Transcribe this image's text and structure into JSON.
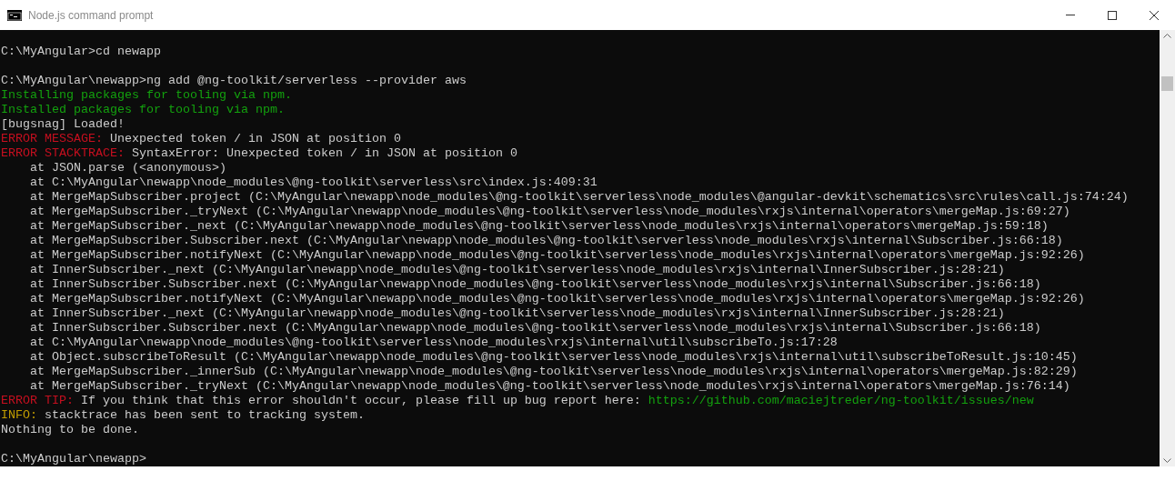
{
  "window": {
    "title": "Node.js command prompt"
  },
  "console": {
    "lines": [
      {
        "kind": "blank"
      },
      {
        "kind": "text",
        "segments": [
          {
            "kind": "plain",
            "text": "C:\\MyAngular>cd newapp"
          }
        ]
      },
      {
        "kind": "blank"
      },
      {
        "kind": "text",
        "segments": [
          {
            "kind": "plain",
            "text": "C:\\MyAngular\\newapp>ng add @ng-toolkit/serverless --provider aws"
          }
        ]
      },
      {
        "kind": "text",
        "segments": [
          {
            "kind": "success",
            "text": "Installing packages for tooling via npm."
          }
        ]
      },
      {
        "kind": "text",
        "segments": [
          {
            "kind": "success",
            "text": "Installed packages for tooling via npm."
          }
        ]
      },
      {
        "kind": "text",
        "segments": [
          {
            "kind": "plain",
            "text": "[bugsnag] Loaded!"
          }
        ]
      },
      {
        "kind": "text",
        "segments": [
          {
            "kind": "error",
            "text": "ERROR MESSAGE:"
          },
          {
            "kind": "plain",
            "text": " Unexpected token / in JSON at position 0"
          }
        ]
      },
      {
        "kind": "text",
        "segments": [
          {
            "kind": "error",
            "text": "ERROR STACKTRACE:"
          },
          {
            "kind": "plain",
            "text": " SyntaxError: Unexpected token / in JSON at position 0"
          }
        ]
      },
      {
        "kind": "text",
        "segments": [
          {
            "kind": "plain",
            "text": "    at JSON.parse (<anonymous>)"
          }
        ]
      },
      {
        "kind": "text",
        "segments": [
          {
            "kind": "plain",
            "text": "    at C:\\MyAngular\\newapp\\node_modules\\@ng-toolkit\\serverless\\src\\index.js:409:31"
          }
        ]
      },
      {
        "kind": "text",
        "segments": [
          {
            "kind": "plain",
            "text": "    at MergeMapSubscriber.project (C:\\MyAngular\\newapp\\node_modules\\@ng-toolkit\\serverless\\node_modules\\@angular-devkit\\schematics\\src\\rules\\call.js:74:24)"
          }
        ]
      },
      {
        "kind": "text",
        "segments": [
          {
            "kind": "plain",
            "text": "    at MergeMapSubscriber._tryNext (C:\\MyAngular\\newapp\\node_modules\\@ng-toolkit\\serverless\\node_modules\\rxjs\\internal\\operators\\mergeMap.js:69:27)"
          }
        ]
      },
      {
        "kind": "text",
        "segments": [
          {
            "kind": "plain",
            "text": "    at MergeMapSubscriber._next (C:\\MyAngular\\newapp\\node_modules\\@ng-toolkit\\serverless\\node_modules\\rxjs\\internal\\operators\\mergeMap.js:59:18)"
          }
        ]
      },
      {
        "kind": "text",
        "segments": [
          {
            "kind": "plain",
            "text": "    at MergeMapSubscriber.Subscriber.next (C:\\MyAngular\\newapp\\node_modules\\@ng-toolkit\\serverless\\node_modules\\rxjs\\internal\\Subscriber.js:66:18)"
          }
        ]
      },
      {
        "kind": "text",
        "segments": [
          {
            "kind": "plain",
            "text": "    at MergeMapSubscriber.notifyNext (C:\\MyAngular\\newapp\\node_modules\\@ng-toolkit\\serverless\\node_modules\\rxjs\\internal\\operators\\mergeMap.js:92:26)"
          }
        ]
      },
      {
        "kind": "text",
        "segments": [
          {
            "kind": "plain",
            "text": "    at InnerSubscriber._next (C:\\MyAngular\\newapp\\node_modules\\@ng-toolkit\\serverless\\node_modules\\rxjs\\internal\\InnerSubscriber.js:28:21)"
          }
        ]
      },
      {
        "kind": "text",
        "segments": [
          {
            "kind": "plain",
            "text": "    at InnerSubscriber.Subscriber.next (C:\\MyAngular\\newapp\\node_modules\\@ng-toolkit\\serverless\\node_modules\\rxjs\\internal\\Subscriber.js:66:18)"
          }
        ]
      },
      {
        "kind": "text",
        "segments": [
          {
            "kind": "plain",
            "text": "    at MergeMapSubscriber.notifyNext (C:\\MyAngular\\newapp\\node_modules\\@ng-toolkit\\serverless\\node_modules\\rxjs\\internal\\operators\\mergeMap.js:92:26)"
          }
        ]
      },
      {
        "kind": "text",
        "segments": [
          {
            "kind": "plain",
            "text": "    at InnerSubscriber._next (C:\\MyAngular\\newapp\\node_modules\\@ng-toolkit\\serverless\\node_modules\\rxjs\\internal\\InnerSubscriber.js:28:21)"
          }
        ]
      },
      {
        "kind": "text",
        "segments": [
          {
            "kind": "plain",
            "text": "    at InnerSubscriber.Subscriber.next (C:\\MyAngular\\newapp\\node_modules\\@ng-toolkit\\serverless\\node_modules\\rxjs\\internal\\Subscriber.js:66:18)"
          }
        ]
      },
      {
        "kind": "text",
        "segments": [
          {
            "kind": "plain",
            "text": "    at C:\\MyAngular\\newapp\\node_modules\\@ng-toolkit\\serverless\\node_modules\\rxjs\\internal\\util\\subscribeTo.js:17:28"
          }
        ]
      },
      {
        "kind": "text",
        "segments": [
          {
            "kind": "plain",
            "text": "    at Object.subscribeToResult (C:\\MyAngular\\newapp\\node_modules\\@ng-toolkit\\serverless\\node_modules\\rxjs\\internal\\util\\subscribeToResult.js:10:45)"
          }
        ]
      },
      {
        "kind": "text",
        "segments": [
          {
            "kind": "plain",
            "text": "    at MergeMapSubscriber._innerSub (C:\\MyAngular\\newapp\\node_modules\\@ng-toolkit\\serverless\\node_modules\\rxjs\\internal\\operators\\mergeMap.js:82:29)"
          }
        ]
      },
      {
        "kind": "text",
        "segments": [
          {
            "kind": "plain",
            "text": "    at MergeMapSubscriber._tryNext (C:\\MyAngular\\newapp\\node_modules\\@ng-toolkit\\serverless\\node_modules\\rxjs\\internal\\operators\\mergeMap.js:76:14)"
          }
        ]
      },
      {
        "kind": "text",
        "segments": [
          {
            "kind": "error",
            "text": "ERROR TIP:"
          },
          {
            "kind": "plain",
            "text": " If you think that this error shouldn't occur, please fill up bug report here: "
          },
          {
            "kind": "link",
            "text": "https://github.com/maciejtreder/ng-toolkit/issues/new"
          }
        ]
      },
      {
        "kind": "text",
        "segments": [
          {
            "kind": "info",
            "text": "INFO:"
          },
          {
            "kind": "plain",
            "text": " stacktrace has been sent to tracking system."
          }
        ]
      },
      {
        "kind": "text",
        "segments": [
          {
            "kind": "plain",
            "text": "Nothing to be done."
          }
        ]
      },
      {
        "kind": "blank"
      },
      {
        "kind": "text",
        "segments": [
          {
            "kind": "plain",
            "text": "C:\\MyAngular\\newapp>"
          }
        ]
      }
    ]
  }
}
